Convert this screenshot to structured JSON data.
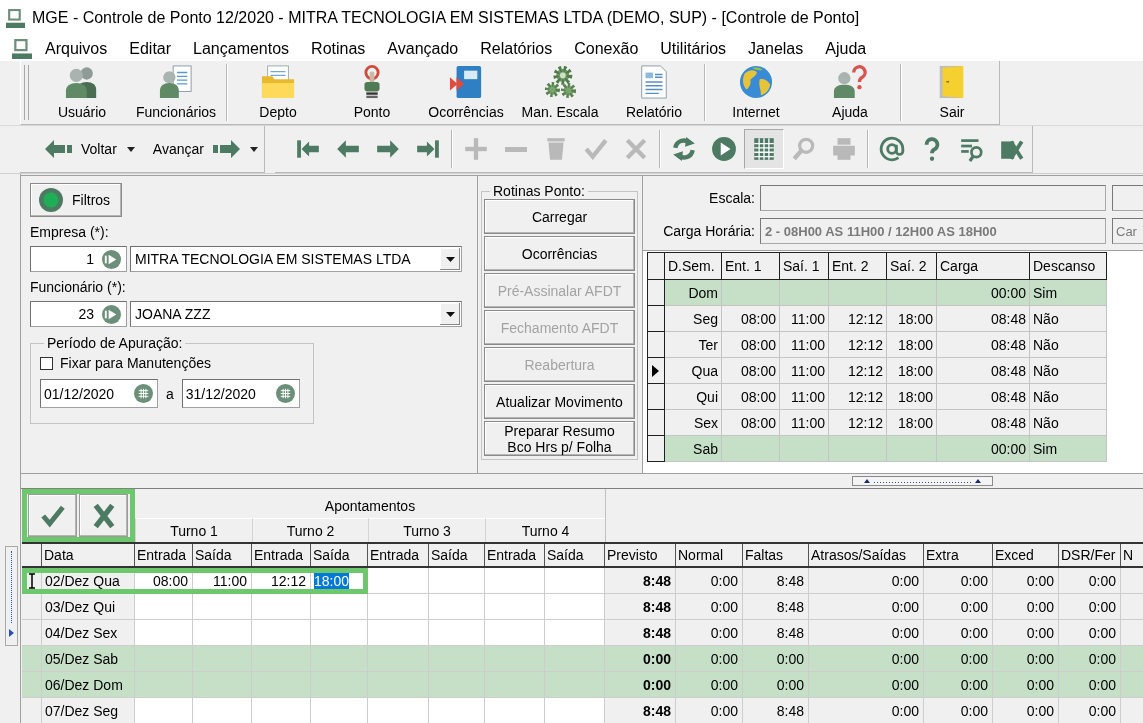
{
  "window": {
    "title": "MGE - Controle de Ponto 12/2020 - MITRA TECNOLOGIA EM SISTEMAS LTDA (DEMO, SUP) - [Controle de Ponto]"
  },
  "menu": [
    "Arquivos",
    "Editar",
    "Lançamentos",
    "Rotinas",
    "Avançado",
    "Relatórios",
    "Conexão",
    "Utilitários",
    "Janelas",
    "Ajuda"
  ],
  "toolbar": {
    "groups": [
      [
        {
          "label": "Usuário",
          "kind": "users"
        },
        {
          "label": "Funcionários",
          "kind": "employees"
        }
      ],
      [
        {
          "label": "Depto",
          "kind": "folder"
        },
        {
          "label": "Ponto",
          "kind": "punch"
        },
        {
          "label": "Ocorrências",
          "kind": "notebook"
        },
        {
          "label": "Man. Escala",
          "kind": "gears"
        },
        {
          "label": "Relatório",
          "kind": "report"
        }
      ],
      [
        {
          "label": "Internet",
          "kind": "globe"
        },
        {
          "label": "Ajuda",
          "kind": "help"
        }
      ],
      [
        {
          "label": "Sair",
          "kind": "door"
        }
      ]
    ]
  },
  "nav_toolbar": {
    "back": "Voltar",
    "forward": "Avançar",
    "groups": [
      [
        {
          "kind": "first",
          "disabled": false,
          "pressed": false
        },
        {
          "kind": "prev",
          "disabled": false,
          "pressed": false
        },
        {
          "kind": "next",
          "disabled": false,
          "pressed": false
        },
        {
          "kind": "last",
          "disabled": false,
          "pressed": false
        }
      ],
      [
        {
          "kind": "add",
          "disabled": true,
          "pressed": false
        },
        {
          "kind": "remove",
          "disabled": true,
          "pressed": false
        },
        {
          "kind": "delete",
          "disabled": true,
          "pressed": false
        },
        {
          "kind": "confirm",
          "disabled": true,
          "pressed": false
        },
        {
          "kind": "cancel",
          "disabled": true,
          "pressed": false
        }
      ],
      [
        {
          "kind": "refresh",
          "disabled": false,
          "pressed": false
        },
        {
          "kind": "play",
          "disabled": false,
          "pressed": false
        },
        {
          "kind": "grid",
          "disabled": false,
          "pressed": true
        },
        {
          "kind": "search",
          "disabled": true,
          "pressed": false
        },
        {
          "kind": "print",
          "disabled": true,
          "pressed": false
        }
      ],
      [
        {
          "kind": "email",
          "disabled": false,
          "pressed": false
        },
        {
          "kind": "help",
          "disabled": false,
          "pressed": false
        },
        {
          "kind": "find_list",
          "disabled": false,
          "pressed": false
        },
        {
          "kind": "export",
          "disabled": false,
          "pressed": false
        }
      ]
    ]
  },
  "filters": {
    "label": "Filtros"
  },
  "empresa": {
    "label": "Empresa (*):",
    "code": "1",
    "name": "MITRA TECNOLOGIA EM SISTEMAS LTDA"
  },
  "funcionario": {
    "label": "Funcionário (*):",
    "code": "23",
    "name": "JOANA ZZZ"
  },
  "periodo": {
    "title": "Período de Apuração:",
    "fixar": {
      "label": "Fixar para Manutenções",
      "checked": false
    },
    "from": "01/12/2020",
    "separator": "a",
    "to": "31/12/2020"
  },
  "rotinas": {
    "title": "Rotinas Ponto:",
    "buttons": [
      {
        "label": "Carregar",
        "disabled": false
      },
      {
        "label": "Ocorrências",
        "disabled": false
      },
      {
        "label": "Pré-Assinalar AFDT",
        "disabled": true
      },
      {
        "label": "Fechamento AFDT",
        "disabled": true
      },
      {
        "label": "Reabertura",
        "disabled": true
      },
      {
        "label": "Atualizar Movimento",
        "disabled": false
      },
      {
        "label": "Preparar Resumo\nBco Hrs p/ Folha",
        "disabled": false
      }
    ]
  },
  "escala": {
    "label": "Escala:"
  },
  "carga_horaria": {
    "label": "Carga Horária:",
    "value": "2 - 08H00 AS 11H00 / 12H00 AS 18H00",
    "side_value": "Car",
    "disabled": true
  },
  "schedule": {
    "columns": [
      "D.Sem.",
      "Ent. 1",
      "Saí. 1",
      "Ent. 2",
      "Saí. 2",
      "Carga",
      "Descanso"
    ],
    "rows": [
      {
        "day": "Dom",
        "rest_day": true,
        "selected": false,
        "carga": "00:00",
        "descanso": "Sim"
      },
      {
        "day": "Seg",
        "rest_day": false,
        "selected": false,
        "times": [
          "08:00",
          "11:00",
          "12:12",
          "18:00"
        ],
        "carga": "08:48",
        "descanso": "Não"
      },
      {
        "day": "Ter",
        "rest_day": false,
        "selected": false,
        "times": [
          "08:00",
          "11:00",
          "12:12",
          "18:00"
        ],
        "carga": "08:48",
        "descanso": "Não"
      },
      {
        "day": "Qua",
        "rest_day": false,
        "selected": true,
        "times": [
          "08:00",
          "11:00",
          "12:12",
          "18:00"
        ],
        "carga": "08:48",
        "descanso": "Não"
      },
      {
        "day": "Qui",
        "rest_day": false,
        "selected": false,
        "times": [
          "08:00",
          "11:00",
          "12:12",
          "18:00"
        ],
        "carga": "08:48",
        "descanso": "Não"
      },
      {
        "day": "Sex",
        "rest_day": false,
        "selected": false,
        "times": [
          "08:00",
          "11:00",
          "12:12",
          "18:00"
        ],
        "carga": "08:48",
        "descanso": "Não"
      },
      {
        "day": "Sab",
        "rest_day": true,
        "selected": false,
        "carga": "00:00",
        "descanso": "Sim"
      }
    ]
  },
  "confirm_buttons": {
    "highlighted": true
  },
  "apontamentos": {
    "title": "Apontamentos",
    "turnos": [
      "Turno 1",
      "Turno 2",
      "Turno 3",
      "Turno 4"
    ],
    "columns": [
      "Data",
      "Entrada",
      "Saída",
      "Entrada",
      "Saída",
      "Entrada",
      "Saída",
      "Entrada",
      "Saída",
      "Previsto",
      "Normal",
      "Faltas",
      "Atrasos/Saídas",
      "Extra",
      "Exced",
      "DSR/Fer",
      "N"
    ],
    "rows": [
      {
        "date": "02/Dez Qua",
        "rest_day": false,
        "editing": true,
        "highlighted": true,
        "punches": [
          {
            "value": "08:00",
            "selected": false
          },
          {
            "value": "11:00",
            "selected": false
          },
          {
            "value": "12:12",
            "selected": false
          },
          {
            "value": "18:00",
            "selected": true
          }
        ],
        "totals": [
          "8:48",
          "0:00",
          "8:48",
          "0:00",
          "0:00",
          "0:00",
          "0:00"
        ]
      },
      {
        "date": "03/Dez Qui",
        "rest_day": false,
        "editing": false,
        "highlighted": false,
        "totals": [
          "8:48",
          "0:00",
          "8:48",
          "0:00",
          "0:00",
          "0:00",
          "0:00"
        ]
      },
      {
        "date": "04/Dez Sex",
        "rest_day": false,
        "editing": false,
        "highlighted": false,
        "totals": [
          "8:48",
          "0:00",
          "8:48",
          "0:00",
          "0:00",
          "0:00",
          "0:00"
        ]
      },
      {
        "date": "05/Dez Sab",
        "rest_day": true,
        "editing": false,
        "highlighted": false,
        "totals": [
          "0:00",
          "0:00",
          "0:00",
          "0:00",
          "0:00",
          "0:00",
          "0:00"
        ]
      },
      {
        "date": "06/Dez Dom",
        "rest_day": true,
        "editing": false,
        "highlighted": false,
        "totals": [
          "0:00",
          "0:00",
          "0:00",
          "0:00",
          "0:00",
          "0:00",
          "0:00"
        ]
      },
      {
        "date": "07/Dez Seg",
        "rest_day": false,
        "editing": false,
        "highlighted": false,
        "totals": [
          "8:48",
          "0:00",
          "8:48",
          "0:00",
          "0:00",
          "0:00",
          "0:00"
        ]
      }
    ]
  }
}
